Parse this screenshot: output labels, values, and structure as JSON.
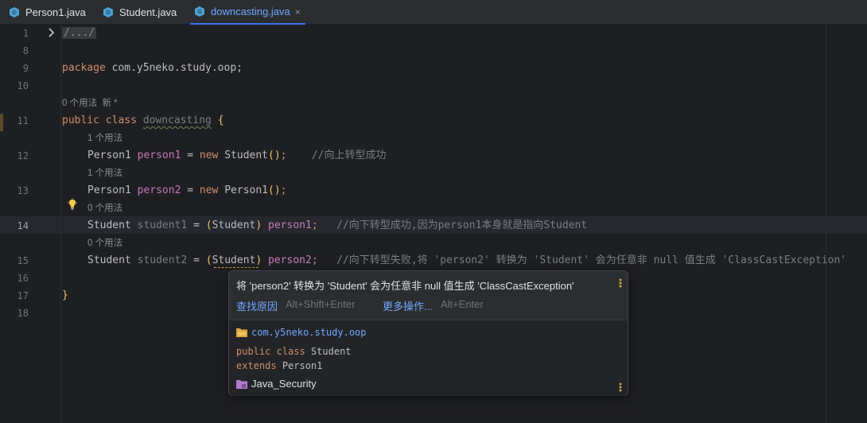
{
  "tabs": [
    {
      "label": "Person1.java"
    },
    {
      "label": "Student.java"
    },
    {
      "label": "downcasting.java",
      "close": "×"
    }
  ],
  "gutter": {
    "line_numbers": [
      "1",
      "8",
      "9",
      "10",
      "11",
      "12",
      "13",
      "14",
      "15",
      "16",
      "17",
      "18"
    ]
  },
  "code": {
    "l1": "/.../",
    "l9_kw": "package",
    "l9_rest": " com.y5neko.study.oop;",
    "hint_class": "0 个用法  新 *",
    "l11_kw1": "public",
    "l11_kw2": "class",
    "l11_name": "downcasting",
    "l11_brace": "{",
    "hint_12": "1 个用法",
    "l12_type": "Person1",
    "l12_var": "person1",
    "l12_eq": " = ",
    "l12_new": "new",
    "l12_ctor": " Student",
    "l12_paren": "()",
    "l12_semi": ";",
    "l12_cmt": "//向上转型成功",
    "hint_13": "1 个用法",
    "l13_type": "Person1",
    "l13_var": "person2",
    "l13_eq": " = ",
    "l13_new": "new",
    "l13_ctor": " Person1",
    "l13_paren": "()",
    "l13_semi": ";",
    "hint_14": "0 个用法",
    "l14_type": "Student",
    "l14_var": "student1",
    "l14_eq": " = ",
    "l14_cast_open": "(",
    "l14_cast": "Student",
    "l14_cast_close": ")",
    "l14_src": "person1",
    "l14_semi": ";",
    "l14_cmt": "//向下转型成功,因为person1本身就是指向Student",
    "hint_15": "0 个用法",
    "l15_type": "Student",
    "l15_var": "student2",
    "l15_eq": " = ",
    "l15_cast_open": "(",
    "l15_cast": "Student",
    "l15_cast_close": ")",
    "l15_src": "person2",
    "l15_semi": ";",
    "l15_cmt": "//向下转型失败,将 'person2' 转换为 'Student' 会为任意非 null 值生成 'ClassCastException'",
    "l17": "}"
  },
  "popup": {
    "message": "将 'person2' 转换为 'Student' 会为任意非 null 值生成 'ClassCastException'",
    "action1": "查找原因",
    "action1_shortcut": "Alt+Shift+Enter",
    "action2": "更多操作...",
    "action2_shortcut": "Alt+Enter",
    "package": "com.y5neko.study.oop",
    "decl_kw1": "public",
    "decl_kw2": "class",
    "decl_name": "Student",
    "decl_extends": "extends",
    "decl_super": "Person1",
    "project": "Java_Security"
  },
  "colors": {
    "accent": "#3574f0",
    "link": "#6fa8ff",
    "keyword": "#cf8e6d",
    "variable": "#c77dbb",
    "warning": "#d1a446"
  }
}
